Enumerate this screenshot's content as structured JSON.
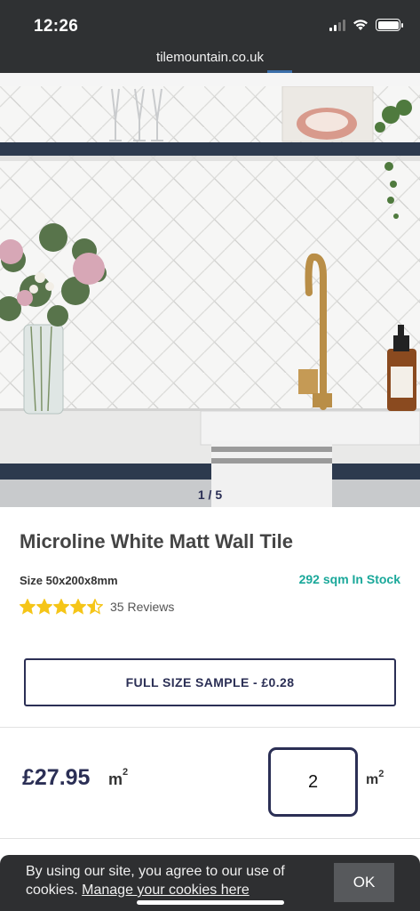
{
  "status": {
    "time": "12:26"
  },
  "browser": {
    "url": "tilemountain.co.uk"
  },
  "gallery": {
    "counter": "1 / 5"
  },
  "product": {
    "title": "Microline White Matt Wall Tile",
    "size": "Size 50x200x8mm",
    "stock": "292 sqm In Stock",
    "rating": 4.5,
    "reviews": "35 Reviews",
    "sample_button": "FULL SIZE SAMPLE - £0.28",
    "price": "£27.95",
    "price_unit": "m",
    "unit_power": "2",
    "quantity": "2",
    "quantity_unit": "m"
  },
  "cookie": {
    "text": "By using our site, you agree to our use of cookies.",
    "link": "Manage your cookies here",
    "ok": "OK"
  },
  "colors": {
    "brand_navy": "#2b2f55",
    "stock_teal": "#1aa89a",
    "star_yellow": "#f5c518"
  }
}
